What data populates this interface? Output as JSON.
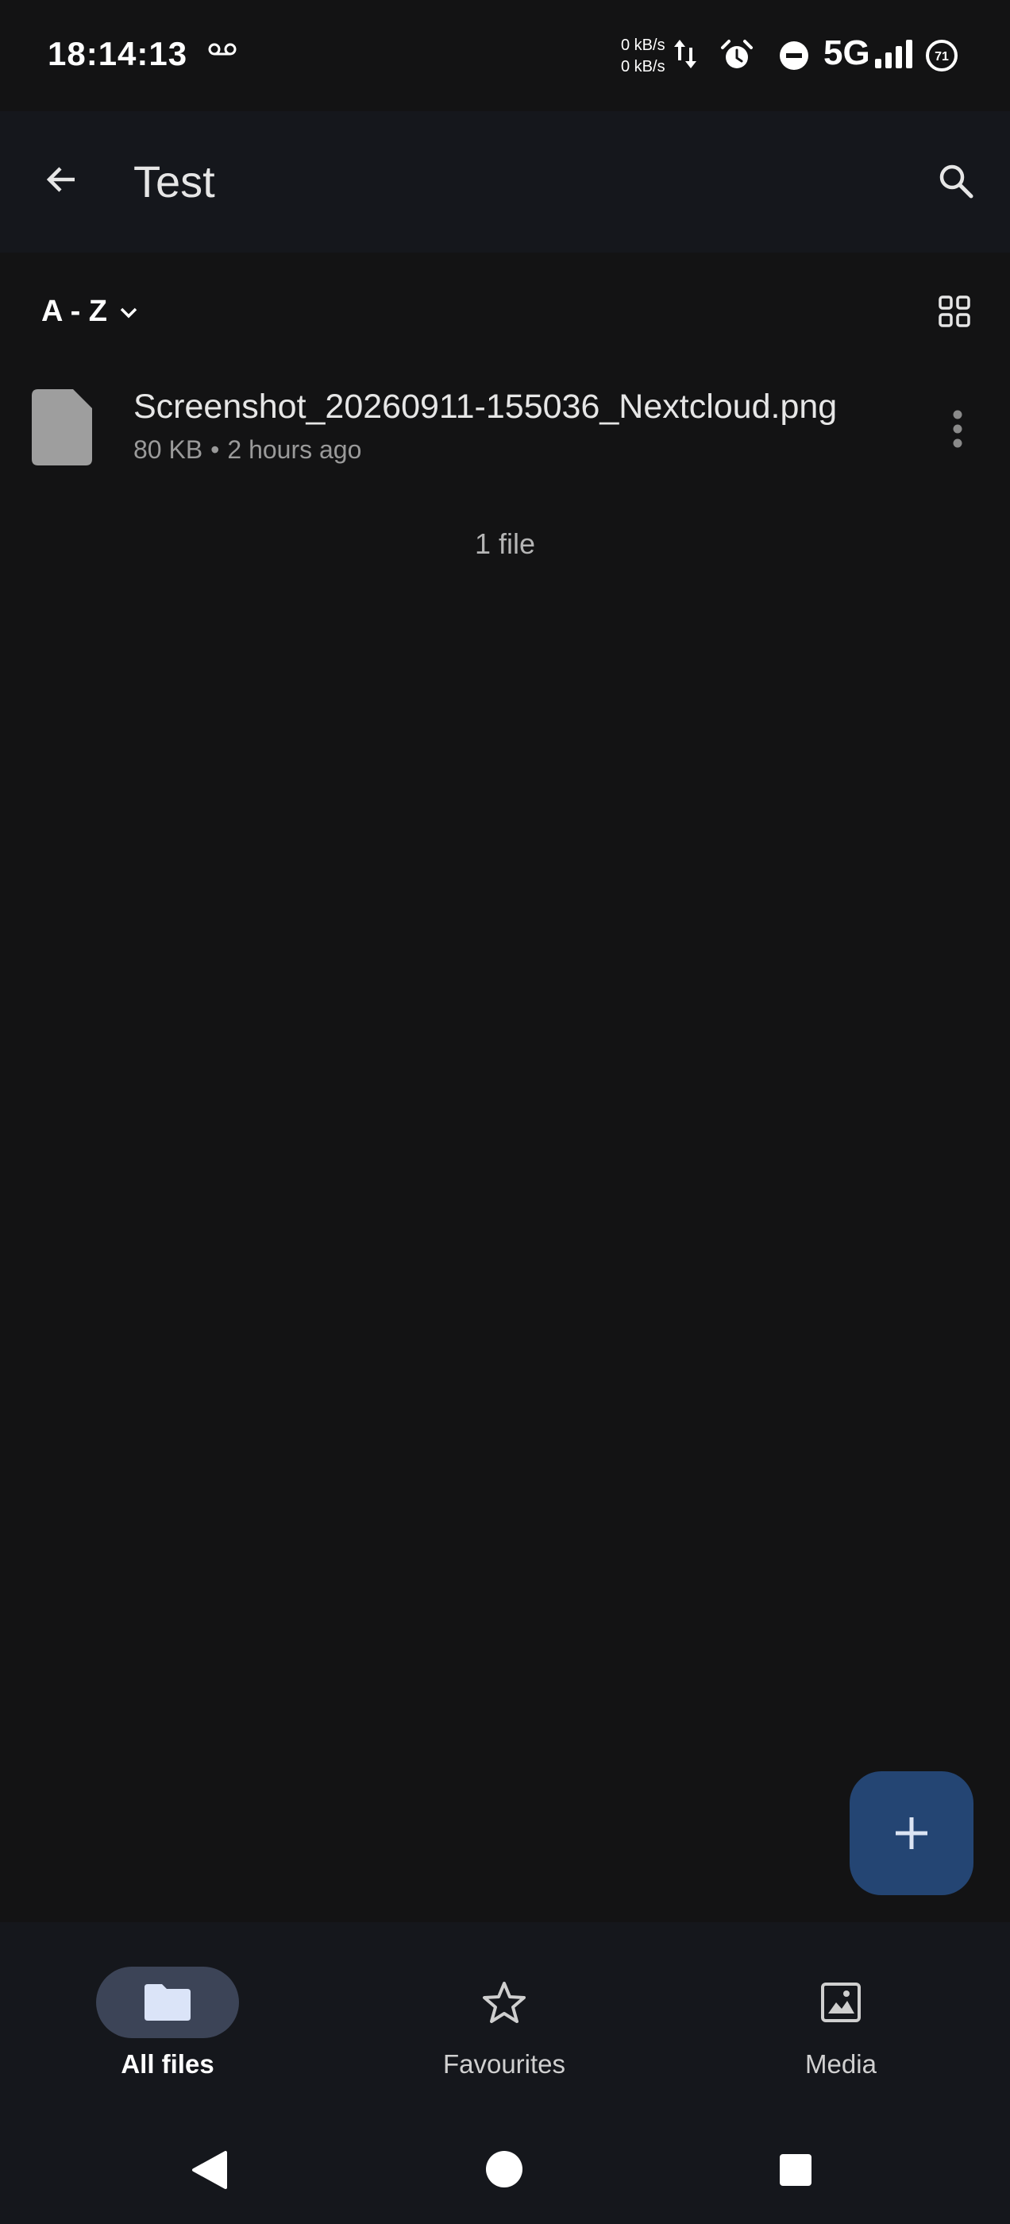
{
  "status_bar": {
    "time": "18:14:13",
    "net_up": "0 kB/s",
    "net_down": "0 kB/s",
    "network": "5G",
    "battery": "71"
  },
  "header": {
    "title": "Test",
    "back_icon": "arrow-back-icon",
    "search_icon": "search-icon"
  },
  "toolbar": {
    "sort_label": "A - Z",
    "view_icon": "grid-view-icon"
  },
  "files": [
    {
      "name": "Screenshot_20260911-155036_Nextcloud.png",
      "size": "80 KB",
      "separator": "•",
      "modified": "2 hours ago",
      "icon": "file-icon"
    }
  ],
  "file_count": "1 file",
  "fab": {
    "icon": "plus-icon"
  },
  "bottom_nav": {
    "items": [
      {
        "label": "All files",
        "icon": "folder-icon",
        "active": true
      },
      {
        "label": "Favourites",
        "icon": "star-icon",
        "active": false
      },
      {
        "label": "Media",
        "icon": "image-icon",
        "active": false
      }
    ]
  },
  "colors": {
    "background": "#131314",
    "bar_background": "#15171c",
    "fab": "#244573",
    "active_pill": "#3c4457"
  }
}
